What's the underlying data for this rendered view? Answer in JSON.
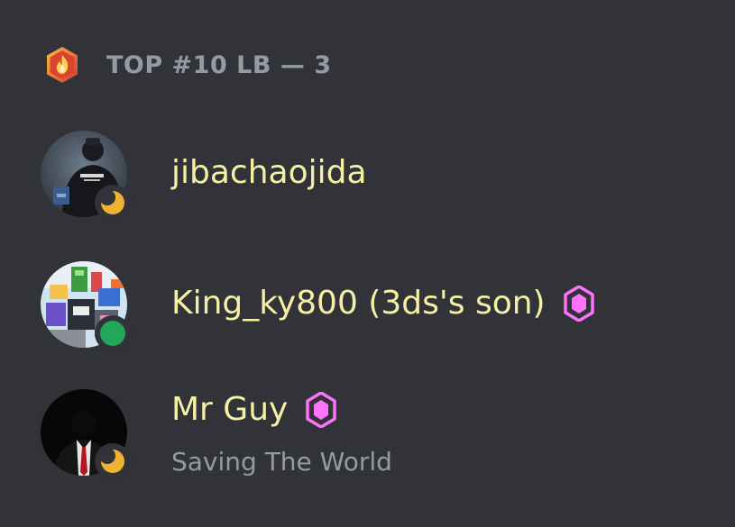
{
  "role": {
    "title": "TOP #10 LB — 3",
    "icon": "role-flame-shield-icon"
  },
  "members": [
    {
      "username": "jibachaojida",
      "status": "idle",
      "status_icon": "moon-icon",
      "avatar": "person-back-photo",
      "badge": null,
      "custom_status": null
    },
    {
      "username": "King_ky800 (3ds's son)",
      "status": "online",
      "status_icon": "online-dot-icon",
      "avatar": "colorful-game-avatar",
      "badge": "server-boost-gem-icon",
      "custom_status": null
    },
    {
      "username": "Mr Guy",
      "status": "idle",
      "status_icon": "moon-icon",
      "avatar": "suited-figure-dark",
      "badge": "server-boost-gem-icon",
      "custom_status": "Saving The World"
    }
  ],
  "colors": {
    "background": "#313338",
    "role_title": "#949ba4",
    "username": "#f5f0a6",
    "custom_status": "#949ba4",
    "idle": "#f0b232",
    "online": "#23a55a",
    "boost": "#ff73fa"
  }
}
